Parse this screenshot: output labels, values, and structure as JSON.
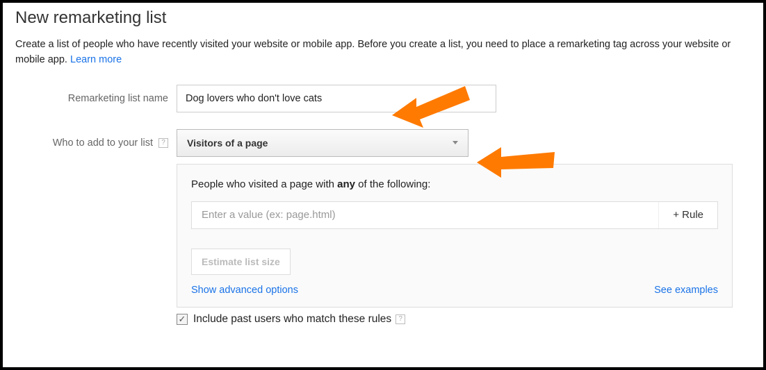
{
  "page": {
    "title": "New remarketing list",
    "intro_text": "Create a list of people who have recently visited your website or mobile app. Before you create a list, you need to place a remarketing tag across your website or mobile app. ",
    "learn_more": "Learn more"
  },
  "fields": {
    "list_name": {
      "label": "Remarketing list name",
      "value": "Dog lovers who don't love cats"
    },
    "who_to_add": {
      "label": "Who to add to your list",
      "selected": "Visitors of a page"
    }
  },
  "rules_panel": {
    "heading_prefix": "People who visited a page with ",
    "heading_bold": "any",
    "heading_suffix": " of the following:",
    "value_placeholder": "Enter a value (ex: page.html)",
    "add_rule_label": "+ Rule",
    "estimate_label": "Estimate list size",
    "show_advanced": "Show advanced options",
    "see_examples": "See examples"
  },
  "include_past": {
    "checked": true,
    "label": "Include past users who match these rules"
  },
  "help_glyph": "?"
}
